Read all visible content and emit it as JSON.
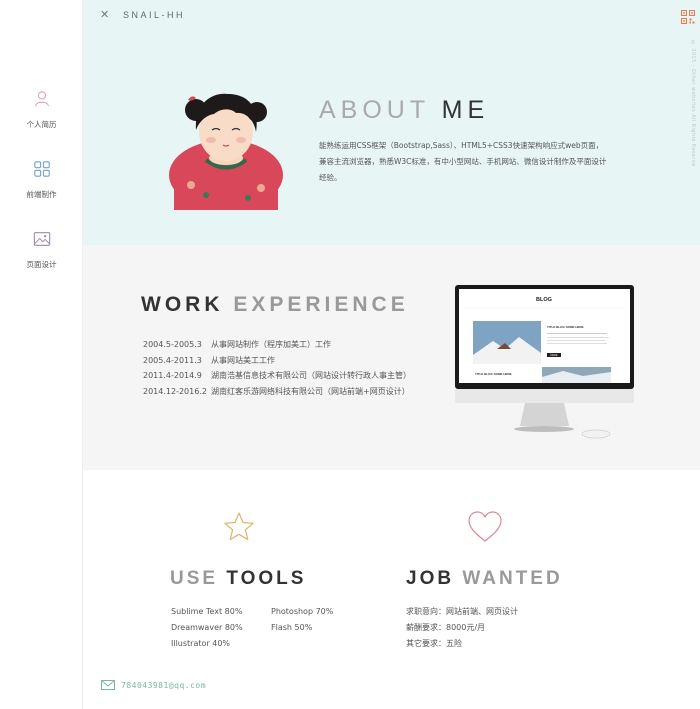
{
  "topbar": {
    "close_glyph": "✕",
    "site_title": "SNAIL-HH"
  },
  "vertical_note": "© 2015 - Other websites All Rights Reserve",
  "sidebar": {
    "items": [
      {
        "label": "个人简历",
        "icon": "person-icon"
      },
      {
        "label": "前端制作",
        "icon": "grid-icon"
      },
      {
        "label": "页面设计",
        "icon": "image-icon"
      }
    ]
  },
  "about": {
    "title_light": "ABOUT",
    "title_dark": "ME",
    "text": "能熟练运用CSS框架（Bootstrap,Sass）、HTML5+CSS3快速架构响应式web页面，兼容主流浏览器，熟悉W3C标准，有中小型网站、手机网站、微信设计制作及平面设计经验。"
  },
  "work": {
    "title_dark": "WORK",
    "title_light": "EXPERIENCE",
    "entries": [
      {
        "date": "2004.5-2005.3",
        "desc": "从事网站制作（程序加美工）工作"
      },
      {
        "date": "2005.4-2011.3",
        "desc": "从事网站美工工作"
      },
      {
        "date": "2011.4-2014.9",
        "desc": "湖南浩基信息技术有限公司（网站设计转行政人事主管）"
      },
      {
        "date": "2014.12-2016.2",
        "desc": "湖南红客乐游网络科技有限公司（网站前端+网页设计）"
      }
    ],
    "monitor_screen": {
      "blog_heading": "BLOG",
      "post_title": "TITLE BLOG SOME HERE",
      "post_title_2": "TITLE BLOG SOME HERE",
      "button": "MORE"
    }
  },
  "tools": {
    "title_light": "USE",
    "title_dark": "TOOLS",
    "items": [
      [
        "Sublime Text  80%",
        "Photoshop  70%"
      ],
      [
        "Dreamwaver  80%",
        "Flash  50%"
      ],
      [
        "Illustrator  40%",
        ""
      ]
    ]
  },
  "job": {
    "title_dark": "JOB",
    "title_light": "WANTED",
    "items": [
      "求职意向：网站前端、网页设计",
      "薪酬要求：8000元/月",
      "其它要求：五险"
    ]
  },
  "contact": {
    "email": "784043981@qq.com"
  },
  "colors": {
    "about_bg": "#e7f5f5",
    "work_bg": "#f5f5f5",
    "accent_pink": "#e6a0b0",
    "accent_teal": "#77b9a6",
    "accent_blue": "#6fa2c7",
    "qr_orange": "#e8784a",
    "star": "#d8b66a",
    "heart": "#d98a95"
  }
}
